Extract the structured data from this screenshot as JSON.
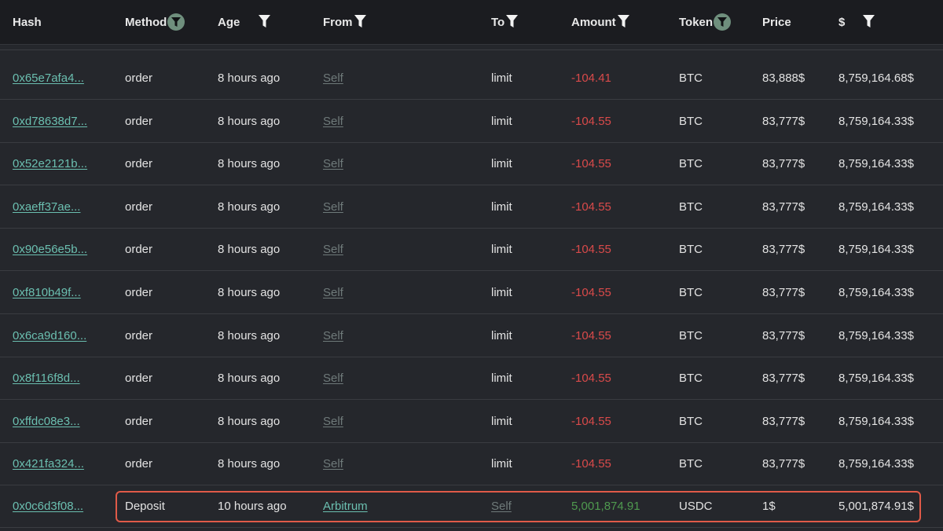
{
  "columns": {
    "hash": "Hash",
    "method": "Method",
    "age": "Age",
    "from": "From",
    "to": "To",
    "amount": "Amount",
    "token": "Token",
    "price": "Price",
    "usd": "$"
  },
  "rows": [
    {
      "hash": "0x65e7afa4...",
      "method": "order",
      "age": "8 hours ago",
      "from": "Self",
      "to": "limit",
      "amount": "-104.41",
      "token": "BTC",
      "price": "83,888$",
      "usd": "8,759,164.68$"
    },
    {
      "hash": "0xd78638d7...",
      "method": "order",
      "age": "8 hours ago",
      "from": "Self",
      "to": "limit",
      "amount": "-104.55",
      "token": "BTC",
      "price": "83,777$",
      "usd": "8,759,164.33$"
    },
    {
      "hash": "0x52e2121b...",
      "method": "order",
      "age": "8 hours ago",
      "from": "Self",
      "to": "limit",
      "amount": "-104.55",
      "token": "BTC",
      "price": "83,777$",
      "usd": "8,759,164.33$"
    },
    {
      "hash": "0xaeff37ae...",
      "method": "order",
      "age": "8 hours ago",
      "from": "Self",
      "to": "limit",
      "amount": "-104.55",
      "token": "BTC",
      "price": "83,777$",
      "usd": "8,759,164.33$"
    },
    {
      "hash": "0x90e56e5b...",
      "method": "order",
      "age": "8 hours ago",
      "from": "Self",
      "to": "limit",
      "amount": "-104.55",
      "token": "BTC",
      "price": "83,777$",
      "usd": "8,759,164.33$"
    },
    {
      "hash": "0xf810b49f...",
      "method": "order",
      "age": "8 hours ago",
      "from": "Self",
      "to": "limit",
      "amount": "-104.55",
      "token": "BTC",
      "price": "83,777$",
      "usd": "8,759,164.33$"
    },
    {
      "hash": "0x6ca9d160...",
      "method": "order",
      "age": "8 hours ago",
      "from": "Self",
      "to": "limit",
      "amount": "-104.55",
      "token": "BTC",
      "price": "83,777$",
      "usd": "8,759,164.33$"
    },
    {
      "hash": "0x8f116f8d...",
      "method": "order",
      "age": "8 hours ago",
      "from": "Self",
      "to": "limit",
      "amount": "-104.55",
      "token": "BTC",
      "price": "83,777$",
      "usd": "8,759,164.33$"
    },
    {
      "hash": "0xffdc08e3...",
      "method": "order",
      "age": "8 hours ago",
      "from": "Self",
      "to": "limit",
      "amount": "-104.55",
      "token": "BTC",
      "price": "83,777$",
      "usd": "8,759,164.33$"
    },
    {
      "hash": "0x421fa324...",
      "method": "order",
      "age": "8 hours ago",
      "from": "Self",
      "to": "limit",
      "amount": "-104.55",
      "token": "BTC",
      "price": "83,777$",
      "usd": "8,759,164.33$"
    }
  ],
  "deposit_row": {
    "hash": "0x0c6d3f08...",
    "method": "Deposit",
    "age": "10 hours ago",
    "from": "Arbitrum",
    "to": "Self",
    "amount": "5,001,874.91",
    "token": "USDC",
    "price": "1$",
    "usd": "5,001,874.91$"
  },
  "colors": {
    "negative": "#d94a4a",
    "positive": "#4f9a4f",
    "link": "#6bbfb0",
    "highlight": "#e05a48"
  }
}
